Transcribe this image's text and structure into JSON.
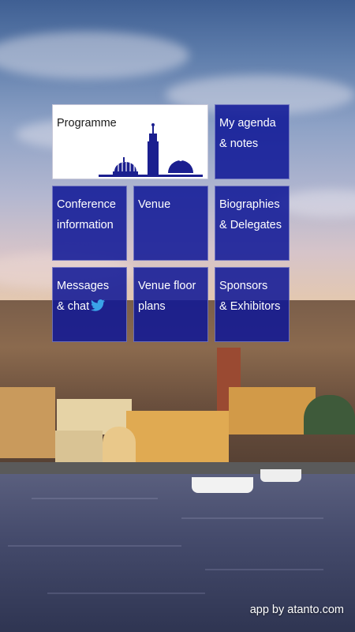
{
  "tiles": {
    "programme": {
      "label": "Programme"
    },
    "agenda": {
      "label": "My agenda\n& notes"
    },
    "conference": {
      "label": "Conference\ninformation"
    },
    "venue": {
      "label": "Venue"
    },
    "biographies": {
      "label": "Biographies\n& Delegates"
    },
    "messages": {
      "label": "Messages\n& chat",
      "icon": "twitter-bird-icon"
    },
    "floorplans": {
      "label": "Venue floor\nplans"
    },
    "sponsors": {
      "label": "Sponsors\n& Exhibitors"
    }
  },
  "colors": {
    "tile_blue": "#0e1696",
    "logo_blue": "#1b1f8f",
    "twitter_blue": "#3aa3e8"
  },
  "footer": {
    "credit": "app by atanto.com"
  }
}
